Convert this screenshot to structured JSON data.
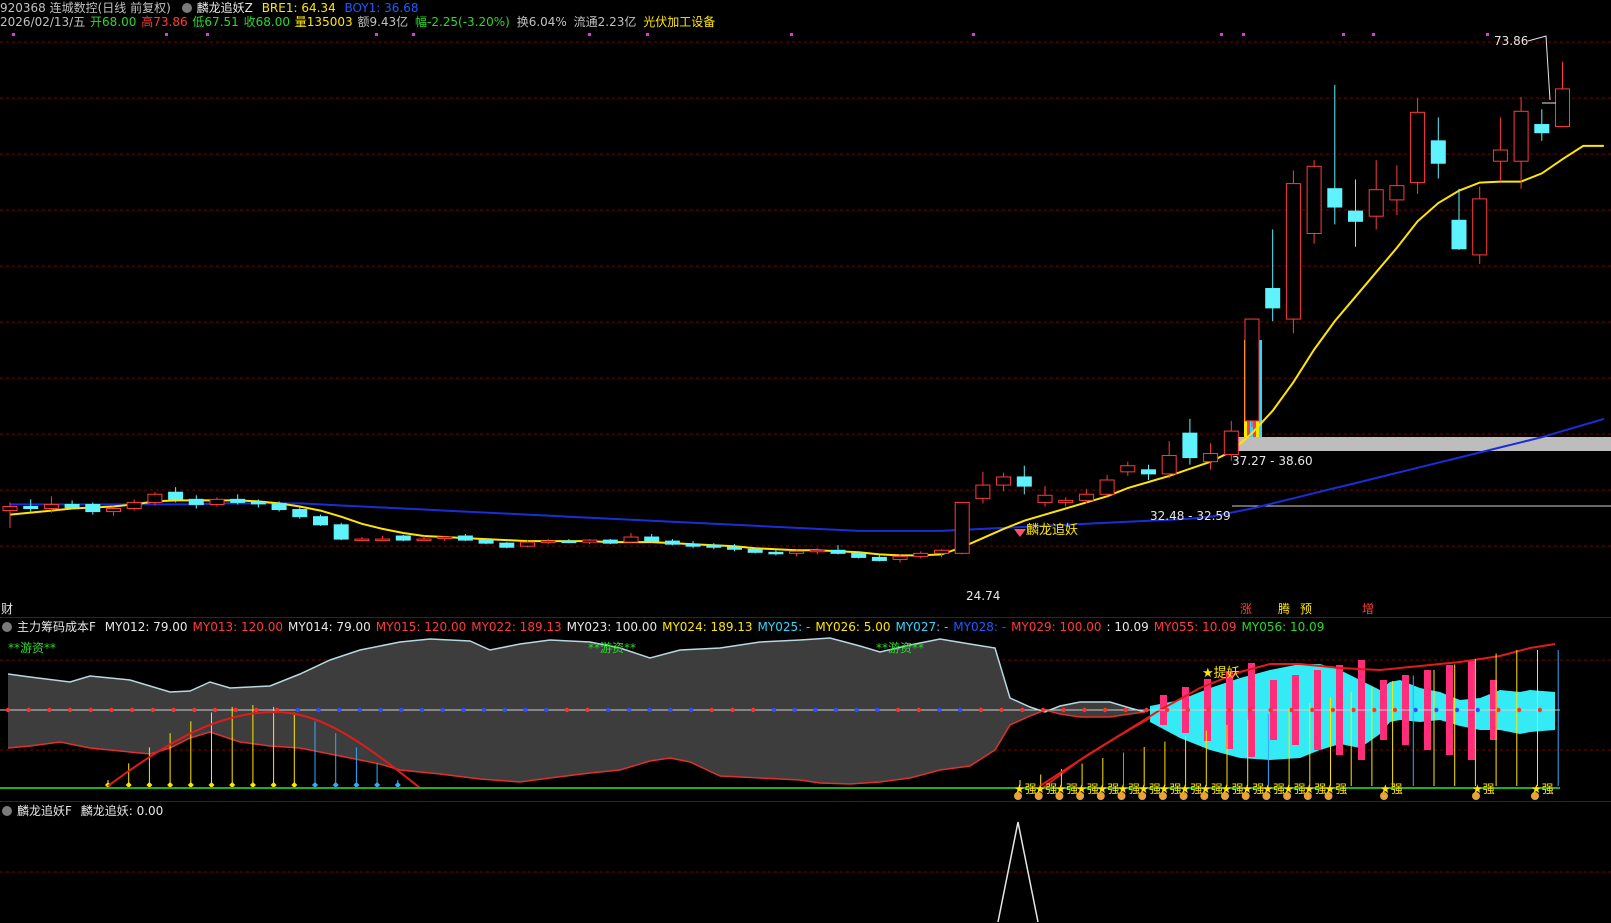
{
  "header": {
    "stock_title": "920368 连城数控(日线 前复权)",
    "indicator_name": "麟龙追妖Z",
    "bre1": "BRE1: 64.34",
    "boy1": "BOY1: 36.68"
  },
  "quote": {
    "date": "2026/02/13/五",
    "open": "开68.00",
    "high": "高73.86",
    "low": "低67.51",
    "close": "收68.00",
    "volume": "量135003",
    "amount": "额9.43亿",
    "change": "幅-2.25(-3.20%)",
    "turnover": "换6.04%",
    "float_cap": "流通2.23亿",
    "sector": "光伏加工设备"
  },
  "main_chart_labels": {
    "max_price": "73.86",
    "min_price": "24.74",
    "zone_upper": "37.27 - 38.60",
    "zone_lower": "32.48 - 32.59",
    "signal_text": "麟龙追妖",
    "left_marker": "财",
    "bottom_markers": [
      "涨",
      "腾",
      "预",
      "增"
    ]
  },
  "panel2": {
    "name": "主力筹码成本F",
    "values": [
      {
        "text": "MY012: 79.00",
        "color": "#e6e6e6"
      },
      {
        "text": "MY013: 120.00",
        "color": "#ff3b3b"
      },
      {
        "text": "MY014: 79.00",
        "color": "#e6e6e6"
      },
      {
        "text": "MY015: 120.00",
        "color": "#ff3b3b"
      },
      {
        "text": "MY022: 189.13",
        "color": "#ff3b3b"
      },
      {
        "text": "MY023: 100.00",
        "color": "#e6e6e6"
      },
      {
        "text": "MY024: 189.13",
        "color": "#ffe600"
      },
      {
        "text": "MY025: -",
        "color": "#33d6ff"
      },
      {
        "text": "MY026: 5.00",
        "color": "#ffe600"
      },
      {
        "text": "MY027: -",
        "color": "#33d6ff"
      },
      {
        "text": "MY028: -",
        "color": "#1e5cff"
      },
      {
        "text": "MY029: 100.00",
        "color": "#ff3b3b"
      },
      {
        "text": ": 10.09",
        "color": "#e6e6e6"
      },
      {
        "text": "MY055: 10.09",
        "color": "#ff3b3b"
      },
      {
        "text": "MY056: 10.09",
        "color": "#2ad92a"
      }
    ],
    "youzi_label": "**游资**",
    "tiyao_label": "★提妖",
    "qiang_label": "★强"
  },
  "panel3": {
    "name": "麟龙追妖F",
    "value": "麟龙追妖: 0.00"
  },
  "colors": {
    "up": "#ff3b3b",
    "down": "#5ef3ff",
    "ma_short": "#ffe600",
    "ma_long": "#1a2ed8",
    "grid": "#7a0000"
  },
  "chart_data": {
    "type": "candlestick",
    "ylim": [
      22,
      76
    ],
    "candles": [
      {
        "o": 29.8,
        "h": 30.6,
        "l": 28.1,
        "c": 30.2
      },
      {
        "o": 30.2,
        "h": 30.9,
        "l": 29.7,
        "c": 30.0
      },
      {
        "o": 30.0,
        "h": 31.2,
        "l": 29.6,
        "c": 30.4
      },
      {
        "o": 30.4,
        "h": 30.8,
        "l": 29.9,
        "c": 30.1
      },
      {
        "o": 30.4,
        "h": 30.6,
        "l": 29.4,
        "c": 29.7
      },
      {
        "o": 29.7,
        "h": 30.2,
        "l": 29.3,
        "c": 30.0
      },
      {
        "o": 30.0,
        "h": 30.9,
        "l": 29.8,
        "c": 30.6
      },
      {
        "o": 30.6,
        "h": 31.6,
        "l": 30.3,
        "c": 31.4
      },
      {
        "o": 31.6,
        "h": 32.1,
        "l": 30.6,
        "c": 30.9
      },
      {
        "o": 30.9,
        "h": 31.3,
        "l": 30.0,
        "c": 30.4
      },
      {
        "o": 30.4,
        "h": 31.1,
        "l": 30.2,
        "c": 30.9
      },
      {
        "o": 30.9,
        "h": 31.4,
        "l": 30.4,
        "c": 30.6
      },
      {
        "o": 30.6,
        "h": 30.9,
        "l": 30.1,
        "c": 30.5
      },
      {
        "o": 30.5,
        "h": 30.7,
        "l": 29.7,
        "c": 29.9
      },
      {
        "o": 29.9,
        "h": 30.1,
        "l": 29.0,
        "c": 29.2
      },
      {
        "o": 29.2,
        "h": 29.4,
        "l": 28.3,
        "c": 28.4
      },
      {
        "o": 28.4,
        "h": 28.6,
        "l": 26.9,
        "c": 27.0
      },
      {
        "o": 27.0,
        "h": 27.2,
        "l": 26.8,
        "c": 27.0
      },
      {
        "o": 27.0,
        "h": 27.3,
        "l": 26.8,
        "c": 27.0
      },
      {
        "o": 27.3,
        "h": 27.4,
        "l": 26.8,
        "c": 26.9
      },
      {
        "o": 27.0,
        "h": 27.3,
        "l": 26.8,
        "c": 27.0
      },
      {
        "o": 27.1,
        "h": 27.3,
        "l": 26.8,
        "c": 27.2
      },
      {
        "o": 27.3,
        "h": 27.5,
        "l": 26.8,
        "c": 26.9
      },
      {
        "o": 26.9,
        "h": 27.0,
        "l": 26.5,
        "c": 26.6
      },
      {
        "o": 26.6,
        "h": 26.7,
        "l": 26.1,
        "c": 26.2
      },
      {
        "o": 26.3,
        "h": 26.9,
        "l": 26.2,
        "c": 26.7
      },
      {
        "o": 26.7,
        "h": 27.0,
        "l": 26.5,
        "c": 26.8
      },
      {
        "o": 26.8,
        "h": 27.0,
        "l": 26.6,
        "c": 26.7
      },
      {
        "o": 26.7,
        "h": 27.0,
        "l": 26.5,
        "c": 26.9
      },
      {
        "o": 26.9,
        "h": 27.0,
        "l": 26.5,
        "c": 26.6
      },
      {
        "o": 26.7,
        "h": 27.6,
        "l": 26.6,
        "c": 27.2
      },
      {
        "o": 27.2,
        "h": 27.5,
        "l": 26.7,
        "c": 26.8
      },
      {
        "o": 26.8,
        "h": 27.0,
        "l": 26.4,
        "c": 26.5
      },
      {
        "o": 26.5,
        "h": 26.8,
        "l": 26.1,
        "c": 26.3
      },
      {
        "o": 26.4,
        "h": 26.6,
        "l": 26.0,
        "c": 26.2
      },
      {
        "o": 26.2,
        "h": 26.5,
        "l": 25.8,
        "c": 26.0
      },
      {
        "o": 26.0,
        "h": 26.2,
        "l": 25.6,
        "c": 25.7
      },
      {
        "o": 25.7,
        "h": 25.9,
        "l": 25.4,
        "c": 25.6
      },
      {
        "o": 25.6,
        "h": 25.9,
        "l": 25.3,
        "c": 25.8
      },
      {
        "o": 25.8,
        "h": 26.1,
        "l": 25.5,
        "c": 25.9
      },
      {
        "o": 25.9,
        "h": 26.4,
        "l": 25.5,
        "c": 25.6
      },
      {
        "o": 25.6,
        "h": 25.7,
        "l": 25.1,
        "c": 25.2
      },
      {
        "o": 25.2,
        "h": 25.4,
        "l": 24.8,
        "c": 24.9
      },
      {
        "o": 25.0,
        "h": 25.5,
        "l": 24.7,
        "c": 25.3
      },
      {
        "o": 25.3,
        "h": 25.8,
        "l": 25.1,
        "c": 25.6
      },
      {
        "o": 25.6,
        "h": 26.0,
        "l": 25.2,
        "c": 25.9
      },
      {
        "o": 25.6,
        "h": 30.6,
        "l": 25.5,
        "c": 30.6
      },
      {
        "o": 31.0,
        "h": 33.6,
        "l": 30.5,
        "c": 32.3
      },
      {
        "o": 32.3,
        "h": 33.5,
        "l": 31.7,
        "c": 33.1
      },
      {
        "o": 33.1,
        "h": 34.2,
        "l": 31.4,
        "c": 32.2
      },
      {
        "o": 30.6,
        "h": 32.2,
        "l": 30.2,
        "c": 31.3
      },
      {
        "o": 30.6,
        "h": 31.1,
        "l": 30.2,
        "c": 30.8
      },
      {
        "o": 30.8,
        "h": 31.9,
        "l": 30.5,
        "c": 31.4
      },
      {
        "o": 31.4,
        "h": 33.3,
        "l": 31.2,
        "c": 32.8
      },
      {
        "o": 33.6,
        "h": 34.6,
        "l": 33.2,
        "c": 34.2
      },
      {
        "o": 33.8,
        "h": 34.3,
        "l": 32.8,
        "c": 33.4
      },
      {
        "o": 33.4,
        "h": 36.6,
        "l": 33.0,
        "c": 35.2
      },
      {
        "o": 37.4,
        "h": 38.8,
        "l": 34.3,
        "c": 35.0
      },
      {
        "o": 34.6,
        "h": 36.4,
        "l": 33.8,
        "c": 35.4
      },
      {
        "o": 35.3,
        "h": 38.6,
        "l": 34.7,
        "c": 37.6
      },
      {
        "o": 38.6,
        "h": 48.6,
        "l": 38.0,
        "c": 48.6
      },
      {
        "o": 51.6,
        "h": 57.4,
        "l": 48.4,
        "c": 49.7
      },
      {
        "o": 48.6,
        "h": 63.2,
        "l": 47.2,
        "c": 61.9
      },
      {
        "o": 57.0,
        "h": 64.2,
        "l": 56.0,
        "c": 63.6
      },
      {
        "o": 61.4,
        "h": 71.6,
        "l": 57.9,
        "c": 59.6
      },
      {
        "o": 59.2,
        "h": 62.3,
        "l": 55.7,
        "c": 58.2
      },
      {
        "o": 58.7,
        "h": 64.2,
        "l": 57.4,
        "c": 61.3
      },
      {
        "o": 60.3,
        "h": 63.7,
        "l": 58.8,
        "c": 61.7
      },
      {
        "o": 62.0,
        "h": 70.3,
        "l": 60.9,
        "c": 68.9
      },
      {
        "o": 66.1,
        "h": 68.4,
        "l": 62.4,
        "c": 63.9
      },
      {
        "o": 58.3,
        "h": 61.4,
        "l": 55.4,
        "c": 55.5
      },
      {
        "o": 54.9,
        "h": 61.6,
        "l": 54.0,
        "c": 60.4
      },
      {
        "o": 64.1,
        "h": 68.4,
        "l": 62.1,
        "c": 65.2
      },
      {
        "o": 64.1,
        "h": 70.4,
        "l": 61.4,
        "c": 69.0
      },
      {
        "o": 67.7,
        "h": 69.2,
        "l": 66.1,
        "c": 66.9
      },
      {
        "o": 67.5,
        "h": 73.86,
        "l": 67.51,
        "c": 71.2
      }
    ],
    "ma_short": [
      29.4,
      29.6,
      29.8,
      30.0,
      30.1,
      30.2,
      30.4,
      30.7,
      30.8,
      30.8,
      30.8,
      30.8,
      30.7,
      30.5,
      30.2,
      29.8,
      29.2,
      28.5,
      28.0,
      27.6,
      27.3,
      27.2,
      27.1,
      27.0,
      26.9,
      26.8,
      26.8,
      26.8,
      26.8,
      26.7,
      26.7,
      26.7,
      26.6,
      26.5,
      26.4,
      26.3,
      26.1,
      26.0,
      25.9,
      25.9,
      25.8,
      25.7,
      25.5,
      25.4,
      25.4,
      25.5,
      26.2,
      27.1,
      28.0,
      28.8,
      29.4,
      30.0,
      30.6,
      31.2,
      32.0,
      32.6,
      33.2,
      33.9,
      34.6,
      35.6,
      37.4,
      39.6,
      42.4,
      45.6,
      48.4,
      50.8,
      53.2,
      55.6,
      58.2,
      60.0,
      61.2,
      62.0,
      62.1,
      62.1,
      62.9,
      64.3,
      65.6,
      65.6
    ],
    "ma_long": [
      30.4,
      30.4,
      30.4,
      30.4,
      30.4,
      30.4,
      30.4,
      30.4,
      30.4,
      30.4,
      30.5,
      30.5,
      30.5,
      30.5,
      30.5,
      30.4,
      30.3,
      30.2,
      30.1,
      30.0,
      29.9,
      29.8,
      29.7,
      29.6,
      29.5,
      29.4,
      29.3,
      29.2,
      29.1,
      29.0,
      28.9,
      28.8,
      28.7,
      28.6,
      28.5,
      28.4,
      28.3,
      28.2,
      28.1,
      28.0,
      27.9,
      27.8,
      27.8,
      27.8,
      27.8,
      27.8,
      27.9,
      28.0,
      28.1,
      28.2,
      28.3,
      28.4,
      28.5,
      28.6,
      28.7,
      28.8,
      28.9,
      29.0,
      29.2,
      29.6,
      30.0,
      30.5,
      31.0,
      31.5,
      32.0,
      32.5,
      33.0,
      33.5,
      34.0,
      34.5,
      35.0,
      35.5,
      36.0,
      36.5,
      37.0,
      37.6,
      38.2,
      38.8
    ]
  }
}
